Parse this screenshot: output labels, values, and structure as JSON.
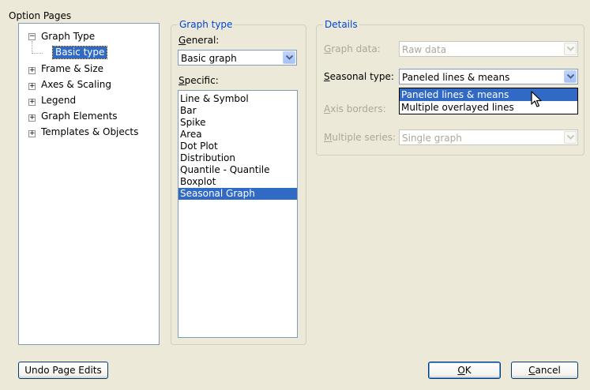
{
  "option_pages": {
    "title": "Option Pages",
    "tree": [
      {
        "expander": "−",
        "label": "Graph Type"
      },
      {
        "label": "Basic type",
        "selected": true
      },
      {
        "expander": "+",
        "label": "Frame & Size"
      },
      {
        "expander": "+",
        "label": "Axes & Scaling"
      },
      {
        "expander": "+",
        "label": "Legend"
      },
      {
        "expander": "+",
        "label": "Graph Elements"
      },
      {
        "expander": "+",
        "label": "Templates & Objects"
      }
    ]
  },
  "graph_type": {
    "title": "Graph type",
    "general_label_m": "G",
    "general_label_rest": "eneral:",
    "general_value": "Basic graph",
    "specific_label_m": "S",
    "specific_label_rest": "pecific:",
    "specific_items": [
      "Line & Symbol",
      "Bar",
      "Spike",
      "Area",
      "Dot Plot",
      "Distribution",
      "Quantile - Quantile",
      "Boxplot",
      "Seasonal Graph"
    ],
    "specific_selected": "Seasonal Graph"
  },
  "details": {
    "title": "Details",
    "graph_data_label_m": "G",
    "graph_data_label_rest": "raph data:",
    "graph_data_value": "Raw data",
    "seasonal_type_label_m": "S",
    "seasonal_type_label_rest": "easonal type:",
    "seasonal_type_value": "Paneled lines & means",
    "seasonal_type_options": [
      "Paneled lines & means",
      "Multiple overlayed lines"
    ],
    "axis_borders_label_m": "A",
    "axis_borders_label_rest": "xis borders:",
    "multiple_series_label_m": "M",
    "multiple_series_label_rest": "ultiple series:",
    "multiple_series_value": "Single graph"
  },
  "buttons": {
    "undo": "Undo Page Edits",
    "ok_m": "O",
    "ok_rest": "K",
    "cancel_m": "C",
    "cancel_rest": "ancel"
  },
  "icons": {
    "dropdown": "chevron-down-icon",
    "cursor": "mouse-pointer-icon"
  },
  "colors": {
    "dialog_bg": "#ece9d8",
    "selection": "#316ac5",
    "group_title": "#0046d5"
  }
}
